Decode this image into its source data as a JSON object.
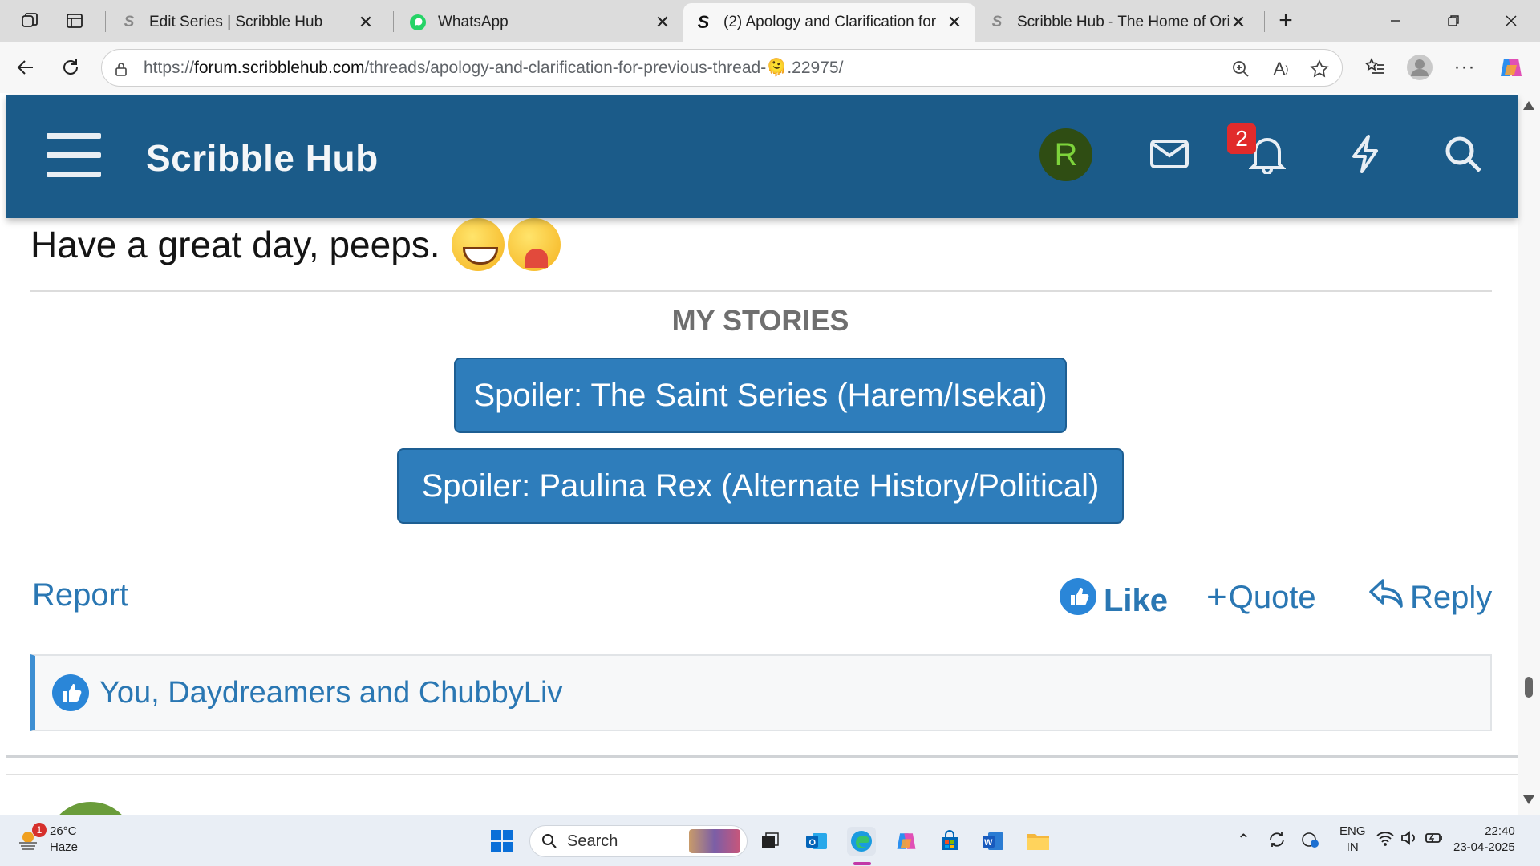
{
  "browser": {
    "tabs": [
      {
        "title": "Edit Series | Scribble Hub",
        "icon": "scribblehub-icon"
      },
      {
        "title": "WhatsApp",
        "icon": "whatsapp-icon"
      },
      {
        "title": "(2) Apology and Clarification for",
        "icon": "scribblehub-icon",
        "active": true
      },
      {
        "title": "Scribble Hub - The Home of Ori",
        "icon": "scribblehub-icon"
      }
    ],
    "new_tab": "+",
    "url_prefix": "https://",
    "url_domain": "forum.scribblehub.com",
    "url_path": "/threads/apology-and-clarification-for-previous-thread-🫠.22975/"
  },
  "site": {
    "brand": "Scribble Hub",
    "avatar_letter": "R",
    "notification_count": "2",
    "colors": {
      "header": "#1b5b89",
      "button": "#2e7dbb",
      "link": "#2a77b3"
    }
  },
  "post": {
    "closing_text": "Have a great day, peeps.",
    "stories_title": "MY STORIES",
    "spoilers": [
      "Spoiler: The Saint Series (Harem/Isekai)",
      "Spoiler: Paulina Rex (Alternate History/Political)"
    ],
    "actions": {
      "report": "Report",
      "like": "Like",
      "quote": "Quote",
      "reply": "Reply"
    },
    "likes_text": "You, Daydreamers and ChubbyLiv"
  },
  "taskbar": {
    "weather": {
      "temp": "26°C",
      "cond": "Haze",
      "badge": "1"
    },
    "search_placeholder": "Search",
    "lang": {
      "line1": "ENG",
      "line2": "IN"
    },
    "clock": {
      "time": "22:40",
      "date": "23-04-2025"
    }
  }
}
